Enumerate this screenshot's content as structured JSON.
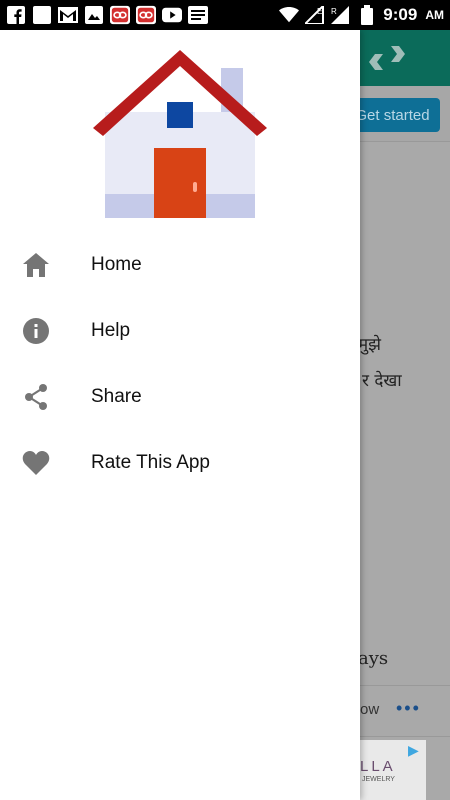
{
  "status_bar": {
    "time": "9:09",
    "ampm": "AM",
    "icons": [
      "facebook-icon",
      "blank-square-icon",
      "gmail-icon",
      "image-icon",
      "app-red-icon",
      "app-red-icon",
      "youtube-icon",
      "news-icon",
      "wifi-icon",
      "signal-icon",
      "battery-icon"
    ]
  },
  "background": {
    "get_started_label": "Get started",
    "text_line1": "मुझे",
    "text_line2": "र देखा",
    "text_line3": "ays",
    "row_text": "ow",
    "more_label": "•••",
    "ad_text": "LLA",
    "ad_sub": "JEWELRY"
  },
  "drawer": {
    "menu": [
      {
        "label": "Home",
        "icon": "home-icon"
      },
      {
        "label": "Help",
        "icon": "info-icon"
      },
      {
        "label": "Share",
        "icon": "share-icon"
      },
      {
        "label": "Rate This App",
        "icon": "heart-icon"
      }
    ]
  },
  "colors": {
    "icon_gray": "#757575",
    "house_roof": "#b71c1c",
    "house_wall": "#e8eaf6",
    "house_door": "#d84315",
    "house_window": "#0d47a1",
    "appbar_teal": "#0b6b5a"
  }
}
